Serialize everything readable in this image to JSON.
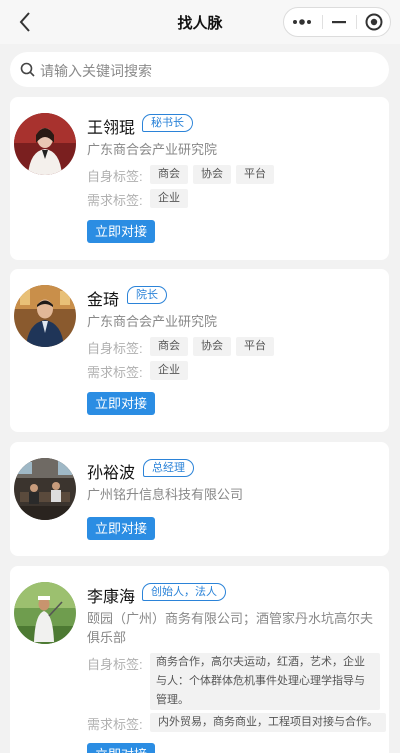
{
  "header": {
    "title": "找人脉",
    "back_icon": "chevron-left-icon",
    "more_icon": "more-dots-icon",
    "minimize_icon": "minimize-icon",
    "close_icon": "target-circle-icon"
  },
  "search": {
    "placeholder": "请输入关键词搜索",
    "icon": "search-icon"
  },
  "labels": {
    "self_tags": "自身标签:",
    "need_tags": "需求标签:",
    "connect": "立即对接"
  },
  "people": [
    {
      "name": "王翎琨",
      "title": "秘书长",
      "org": "广东商合会产业研究院",
      "self_tags": [
        "商会",
        "协会",
        "平台"
      ],
      "need_tags": [
        "企业"
      ]
    },
    {
      "name": "金琦",
      "title": "院长",
      "org": "广东商合会产业研究院",
      "self_tags": [
        "商会",
        "协会",
        "平台"
      ],
      "need_tags": [
        "企业"
      ]
    },
    {
      "name": "孙裕波",
      "title": "总经理",
      "org": "广州铭升信息科技有限公司"
    },
    {
      "name": "李康海",
      "title": "创始人，法人",
      "org": "颐园（广州）商务有限公司；酒管家丹水坑高尔夫俱乐部",
      "self_tags_text": "商务合作，高尔夫运动，红酒，艺术，企业与人：个体群体危机事件处理心理学指导与管理。",
      "need_tags_text": "内外贸易，商务商业，工程项目对接与合作。"
    }
  ],
  "colors": {
    "accent": "#2b8de3",
    "badge": "#2b83d8",
    "background": "#f2f2f2"
  }
}
